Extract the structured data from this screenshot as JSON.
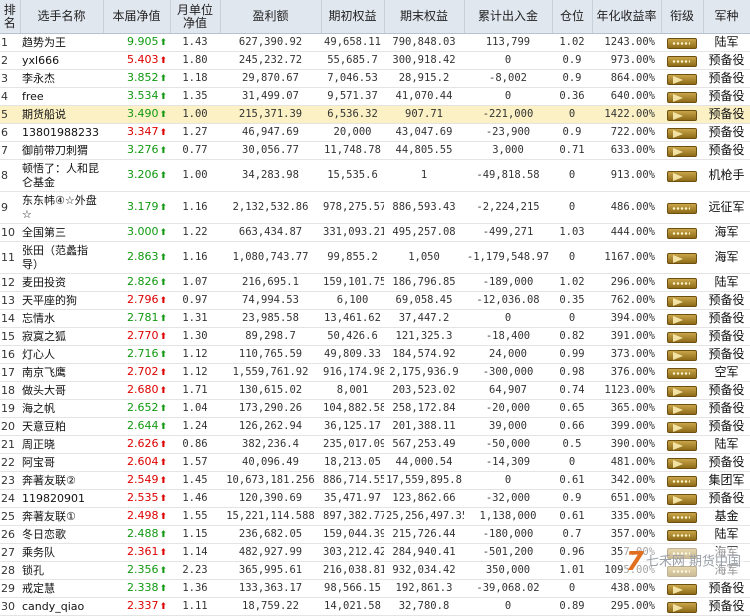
{
  "headers": [
    "排名",
    "选手名称",
    "本届净值",
    "月单位净值",
    "盈利额",
    "期初权益",
    "期末权益",
    "累计出入金",
    "仓位",
    "年化收益率",
    "衔级",
    "军种"
  ],
  "rows": [
    {
      "rank": "1",
      "name": "趋势为王",
      "nav": "9.905",
      "dir": "up",
      "unit": "1.43",
      "profit": "627,390.92",
      "init": "49,658.11",
      "end": "790,848.03",
      "flow": "113,799",
      "pos": "1.02",
      "annual": "1243.00%",
      "badge": "dots",
      "army": "陆军"
    },
    {
      "rank": "2",
      "name": "yxl666",
      "nav": "5.403",
      "dir": "dn",
      "unit": "1.80",
      "profit": "245,232.72",
      "init": "55,685.7",
      "end": "300,918.42",
      "flow": "0",
      "pos": "0.9",
      "annual": "973.00%",
      "badge": "dots",
      "army": "预备役"
    },
    {
      "rank": "3",
      "name": "李永杰",
      "nav": "3.852",
      "dir": "up",
      "unit": "1.18",
      "profit": "29,870.67",
      "init": "7,046.53",
      "end": "28,915.2",
      "flow": "-8,002",
      "pos": "0.9",
      "annual": "864.00%",
      "badge": "chev",
      "army": "预备役"
    },
    {
      "rank": "4",
      "name": "free",
      "nav": "3.534",
      "dir": "up",
      "unit": "1.35",
      "profit": "31,499.07",
      "init": "9,571.37",
      "end": "41,070.44",
      "flow": "0",
      "pos": "0.36",
      "annual": "640.00%",
      "badge": "chev",
      "army": "预备役"
    },
    {
      "rank": "5",
      "name": "期货船说",
      "nav": "3.490",
      "dir": "up",
      "unit": "1.00",
      "profit": "215,371.39",
      "init": "6,536.32",
      "end": "907.71",
      "flow": "-221,000",
      "pos": "0",
      "annual": "1422.00%",
      "badge": "chev",
      "army": "预备役",
      "hl": true
    },
    {
      "rank": "6",
      "name": "13801988233",
      "nav": "3.347",
      "dir": "dn",
      "unit": "1.27",
      "profit": "46,947.69",
      "init": "20,000",
      "end": "43,047.69",
      "flow": "-23,900",
      "pos": "0.9",
      "annual": "722.00%",
      "badge": "chev",
      "army": "预备役"
    },
    {
      "rank": "7",
      "name": "御前带刀刺猬",
      "nav": "3.276",
      "dir": "up",
      "unit": "0.77",
      "profit": "30,056.77",
      "init": "11,748.78",
      "end": "44,805.55",
      "flow": "3,000",
      "pos": "0.71",
      "annual": "633.00%",
      "badge": "chev",
      "army": "预备役"
    },
    {
      "rank": "8",
      "name": "顿悟了：人和昆仑基金",
      "nav": "3.206",
      "dir": "up",
      "unit": "1.00",
      "profit": "34,283.98",
      "init": "15,535.6",
      "end": "1",
      "flow": "-49,818.58",
      "pos": "0",
      "annual": "913.00%",
      "badge": "chev",
      "army": "机枪手",
      "tall": true
    },
    {
      "rank": "9",
      "name": "东东帏④☆外盘☆",
      "nav": "3.179",
      "dir": "up",
      "unit": "1.16",
      "profit": "2,132,532.86",
      "init": "978,275.57",
      "end": "886,593.43",
      "flow": "-2,224,215",
      "pos": "0",
      "annual": "486.00%",
      "badge": "dots",
      "army": "远征军",
      "tall": true
    },
    {
      "rank": "10",
      "name": "全国第三",
      "nav": "3.000",
      "dir": "up",
      "unit": "1.22",
      "profit": "663,434.87",
      "init": "331,093.21",
      "end": "495,257.08",
      "flow": "-499,271",
      "pos": "1.03",
      "annual": "444.00%",
      "badge": "dots",
      "army": "海军"
    },
    {
      "rank": "11",
      "name": "张田（范蠡指导）",
      "nav": "2.863",
      "dir": "up",
      "unit": "1.16",
      "profit": "1,080,743.77",
      "init": "99,855.2",
      "end": "1,050",
      "flow": "-1,179,548.97",
      "pos": "0",
      "annual": "1167.00%",
      "badge": "chev",
      "army": "海军",
      "tall": true
    },
    {
      "rank": "12",
      "name": "麦田投资",
      "nav": "2.826",
      "dir": "up",
      "unit": "1.07",
      "profit": "216,695.1",
      "init": "159,101.75",
      "end": "186,796.85",
      "flow": "-189,000",
      "pos": "1.02",
      "annual": "296.00%",
      "badge": "dots",
      "army": "陆军"
    },
    {
      "rank": "13",
      "name": "天平座的狗",
      "nav": "2.796",
      "dir": "dn",
      "unit": "0.97",
      "profit": "74,994.53",
      "init": "6,100",
      "end": "69,058.45",
      "flow": "-12,036.08",
      "pos": "0.35",
      "annual": "762.00%",
      "badge": "chev",
      "army": "预备役"
    },
    {
      "rank": "14",
      "name": "忘情水",
      "nav": "2.781",
      "dir": "up",
      "unit": "1.31",
      "profit": "23,985.58",
      "init": "13,461.62",
      "end": "37,447.2",
      "flow": "0",
      "pos": "0",
      "annual": "394.00%",
      "badge": "chev",
      "army": "预备役"
    },
    {
      "rank": "15",
      "name": "寂寞之狐",
      "nav": "2.770",
      "dir": "dn",
      "unit": "1.30",
      "profit": "89,298.7",
      "init": "50,426.6",
      "end": "121,325.3",
      "flow": "-18,400",
      "pos": "0.82",
      "annual": "391.00%",
      "badge": "chev",
      "army": "预备役"
    },
    {
      "rank": "16",
      "name": "灯心人",
      "nav": "2.716",
      "dir": "up",
      "unit": "1.12",
      "profit": "110,765.59",
      "init": "49,809.33",
      "end": "184,574.92",
      "flow": "24,000",
      "pos": "0.99",
      "annual": "373.00%",
      "badge": "chev",
      "army": "预备役"
    },
    {
      "rank": "17",
      "name": "南京飞鹰",
      "nav": "2.702",
      "dir": "dn",
      "unit": "1.12",
      "profit": "1,559,761.92",
      "init": "916,174.98",
      "end": "2,175,936.9",
      "flow": "-300,000",
      "pos": "0.98",
      "annual": "376.00%",
      "badge": "dots",
      "army": "空军"
    },
    {
      "rank": "18",
      "name": "做头大哥",
      "nav": "2.680",
      "dir": "dn",
      "unit": "1.71",
      "profit": "130,615.02",
      "init": "8,001",
      "end": "203,523.02",
      "flow": "64,907",
      "pos": "0.74",
      "annual": "1123.00%",
      "badge": "chev",
      "army": "预备役"
    },
    {
      "rank": "19",
      "name": "海之帆",
      "nav": "2.652",
      "dir": "up",
      "unit": "1.04",
      "profit": "173,290.26",
      "init": "104,882.58",
      "end": "258,172.84",
      "flow": "-20,000",
      "pos": "0.65",
      "annual": "365.00%",
      "badge": "chev",
      "army": "预备役"
    },
    {
      "rank": "20",
      "name": "天意豆粕",
      "nav": "2.644",
      "dir": "up",
      "unit": "1.24",
      "profit": "126,262.94",
      "init": "36,125.17",
      "end": "201,388.11",
      "flow": "39,000",
      "pos": "0.66",
      "annual": "399.00%",
      "badge": "chev",
      "army": "预备役"
    },
    {
      "rank": "21",
      "name": "周正晓",
      "nav": "2.626",
      "dir": "dn",
      "unit": "0.86",
      "profit": "382,236.4",
      "init": "235,017.09",
      "end": "567,253.49",
      "flow": "-50,000",
      "pos": "0.5",
      "annual": "390.00%",
      "badge": "chev",
      "army": "陆军"
    },
    {
      "rank": "22",
      "name": "阿宝哥",
      "nav": "2.604",
      "dir": "dn",
      "unit": "1.57",
      "profit": "40,096.49",
      "init": "18,213.05",
      "end": "44,000.54",
      "flow": "-14,309",
      "pos": "0",
      "annual": "481.00%",
      "badge": "chev",
      "army": "预备役"
    },
    {
      "rank": "23",
      "name": "奔著友联②",
      "nav": "2.549",
      "dir": "dn",
      "unit": "1.45",
      "profit": "10,673,181.256",
      "init": "886,714.55",
      "end": "17,559,895.8",
      "flow": "0",
      "pos": "0.61",
      "annual": "342.00%",
      "badge": "dots",
      "army": "集团军"
    },
    {
      "rank": "24",
      "name": "119820901",
      "nav": "2.535",
      "dir": "dn",
      "unit": "1.46",
      "profit": "120,390.69",
      "init": "35,471.97",
      "end": "123,862.66",
      "flow": "-32,000",
      "pos": "0.9",
      "annual": "651.00%",
      "badge": "chev",
      "army": "预备役"
    },
    {
      "rank": "25",
      "name": "奔著友联①",
      "nav": "2.498",
      "dir": "dn",
      "unit": "1.55",
      "profit": "15,221,114.588",
      "init": "897,382.77",
      "end": "25,256,497.35",
      "flow": "1,138,000",
      "pos": "0.61",
      "annual": "335.00%",
      "badge": "dots",
      "army": "基金"
    },
    {
      "rank": "26",
      "name": "冬日恋歌",
      "nav": "2.488",
      "dir": "up",
      "unit": "1.15",
      "profit": "236,682.05",
      "init": "159,044.39",
      "end": "215,726.44",
      "flow": "-180,000",
      "pos": "0.7",
      "annual": "357.00%",
      "badge": "dots",
      "army": "陆军"
    },
    {
      "rank": "27",
      "name": "乘务队",
      "nav": "2.361",
      "dir": "dn",
      "unit": "1.14",
      "profit": "482,927.99",
      "init": "303,212.42",
      "end": "284,940.41",
      "flow": "-501,200",
      "pos": "0.96",
      "annual": "357.00%",
      "badge": "dots",
      "army": "海军"
    },
    {
      "rank": "28",
      "name": "锁孔",
      "nav": "2.356",
      "dir": "up",
      "unit": "2.23",
      "profit": "365,995.61",
      "init": "216,038.81",
      "end": "932,034.42",
      "flow": "350,000",
      "pos": "1.01",
      "annual": "1095.00%",
      "badge": "dots",
      "army": "海军"
    },
    {
      "rank": "29",
      "name": "戒定慧",
      "nav": "2.338",
      "dir": "up",
      "unit": "1.36",
      "profit": "133,363.17",
      "init": "98,566.15",
      "end": "192,861.3",
      "flow": "-39,068.02",
      "pos": "0",
      "annual": "438.00%",
      "badge": "chev",
      "army": "预备役"
    },
    {
      "rank": "30",
      "name": "candy_qiao",
      "nav": "2.337",
      "dir": "dn",
      "unit": "1.11",
      "profit": "18,759.22",
      "init": "14,021.58",
      "end": "32,780.8",
      "flow": "0",
      "pos": "0.89",
      "annual": "295.00%",
      "badge": "chev",
      "army": "预备役"
    }
  ],
  "watermark": "七禾网 期货中国",
  "icons": {
    "up": "green-up-arrow",
    "dn": "red-up-arrow"
  },
  "colors": {
    "up": "#119911",
    "dn": "#dd0000",
    "header_bg": "#e1e7ef",
    "highlight": "#fbf1c5"
  }
}
